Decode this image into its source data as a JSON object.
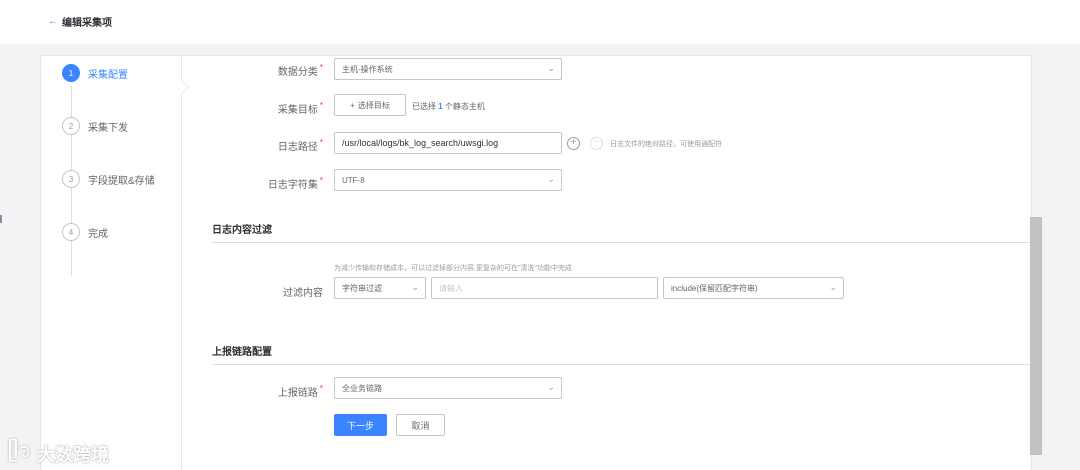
{
  "header": {
    "back_label": "编辑采集项"
  },
  "steps": [
    {
      "num": "1",
      "label": "采集配置"
    },
    {
      "num": "2",
      "label": "采集下发"
    },
    {
      "num": "3",
      "label": "字段提取&存储"
    },
    {
      "num": "4",
      "label": "完成"
    }
  ],
  "form": {
    "data_category": {
      "label": "数据分类",
      "value": "主机-操作系统"
    },
    "target": {
      "label": "采集目标",
      "button": "选择目标",
      "selected_prefix": "已选择",
      "selected_count": "1",
      "selected_suffix": "个静态主机"
    },
    "log_path": {
      "label": "日志路径",
      "value": "/usr/local/logs/bk_log_search/uwsgi.log",
      "hint": "日志文件的绝对路径，可使用通配符"
    },
    "charset": {
      "label": "日志字符集",
      "value": "UTF-8"
    }
  },
  "filter_section": {
    "title": "日志内容过滤",
    "hint": "为减少传输和存储成本，可以过滤掉部分内容,更复杂的可在\"清洗\"功能中完成",
    "label": "过滤内容",
    "type_value": "字符串过滤",
    "keyword_placeholder": "请输入",
    "mode_value": "include(保留匹配字符串)"
  },
  "report_section": {
    "title": "上报链路配置",
    "label": "上报链路",
    "value": "全业务链路"
  },
  "actions": {
    "next": "下一步",
    "cancel": "取消"
  },
  "watermark": {
    "text": "大数跨境"
  }
}
